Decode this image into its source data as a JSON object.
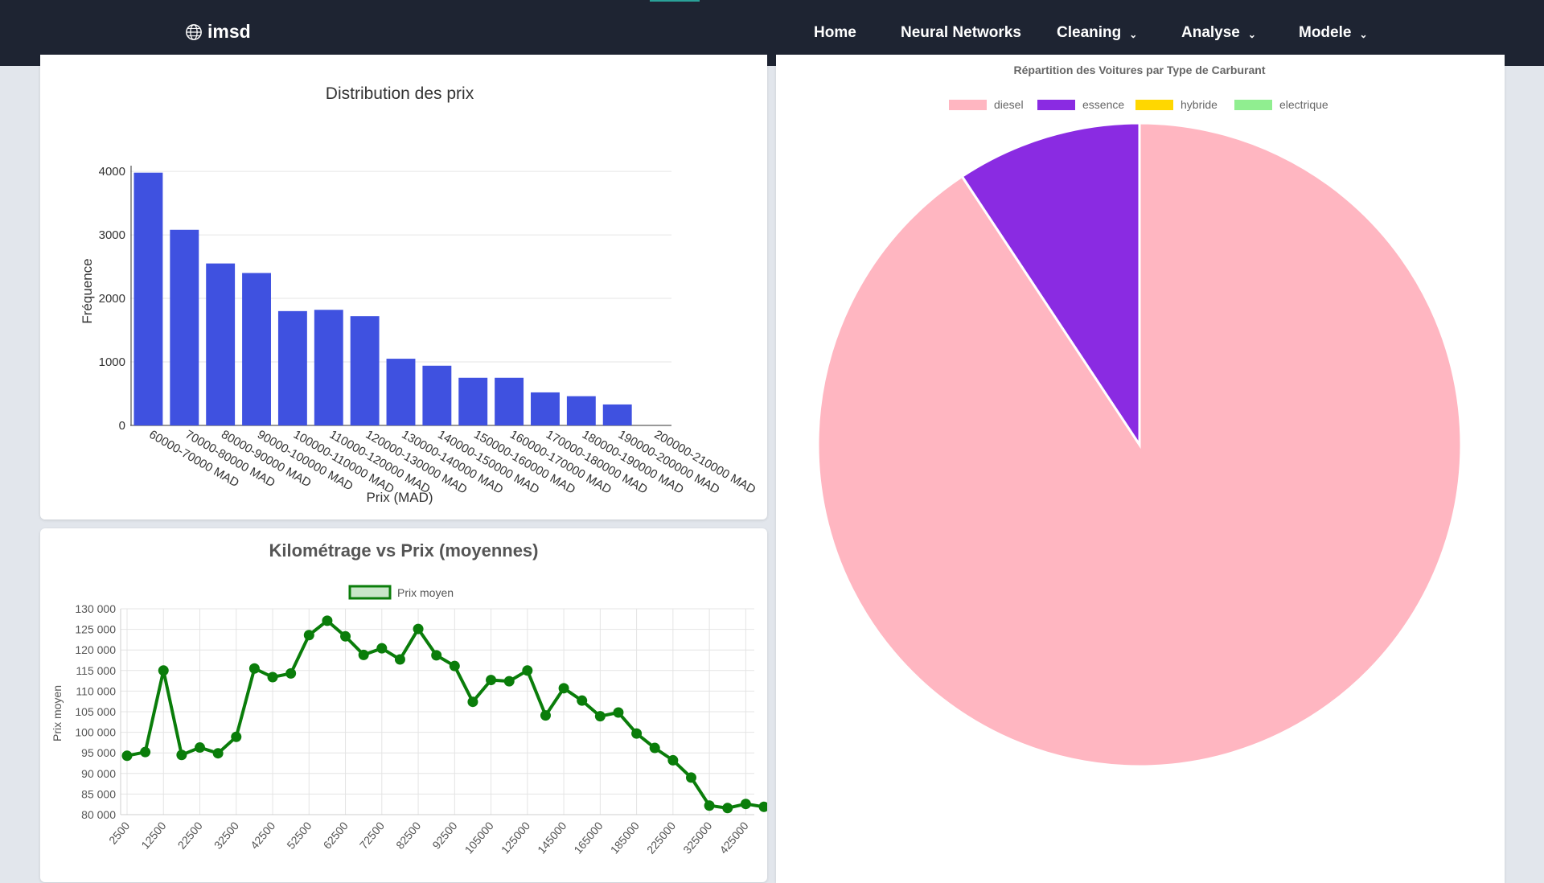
{
  "header": {
    "brand": "imsd",
    "nav": [
      {
        "label": "Home"
      },
      {
        "label": "Neural Networks"
      },
      {
        "label": "Cleaning"
      },
      {
        "label": "Analyse"
      },
      {
        "label": "Modele"
      }
    ]
  },
  "colors": {
    "navbar": "#1e2432",
    "bar": "#3f51e0",
    "line": "#0a7d0a",
    "diesel": "#ffb6c1",
    "essence": "#8a2be2",
    "hybride": "#ffd700",
    "electrique": "#90ee90"
  },
  "chart_data": [
    {
      "type": "bar",
      "title": "Distribution des prix",
      "xlabel": "Prix (MAD)",
      "ylabel": "Fréquence",
      "ylim": [
        0,
        4000
      ],
      "yticks": [
        0,
        1000,
        2000,
        3000,
        4000
      ],
      "grid": true,
      "categories": [
        "60000-70000 MAD",
        "70000-80000 MAD",
        "80000-90000 MAD",
        "90000-100000 MAD",
        "100000-110000 MAD",
        "110000-120000 MAD",
        "120000-130000 MAD",
        "130000-140000 MAD",
        "140000-150000 MAD",
        "150000-160000 MAD",
        "160000-170000 MAD",
        "170000-180000 MAD",
        "180000-190000 MAD",
        "190000-200000 MAD",
        "200000-210000 MAD"
      ],
      "values": [
        3980,
        3080,
        2550,
        2400,
        1800,
        1820,
        1720,
        1050,
        940,
        750,
        750,
        520,
        460,
        330,
        0
      ]
    },
    {
      "type": "line",
      "title": "Kilométrage vs Prix (moyennes)",
      "ylabel": "Prix moyen",
      "ylim": [
        80000,
        130000
      ],
      "yticks": [
        "80 000",
        "85 000",
        "90 000",
        "95 000",
        "100 000",
        "105 000",
        "110 000",
        "115 000",
        "120 000",
        "125 000",
        "130 000"
      ],
      "grid": true,
      "legend_position": "top",
      "series": [
        {
          "name": "Prix moyen",
          "values": [
            94300,
            95200,
            115000,
            94500,
            96300,
            94900,
            98900,
            115500,
            113400,
            114300,
            123600,
            127100,
            123300,
            118800,
            120400,
            117700,
            125100,
            118700,
            116100,
            107400,
            112700,
            112400,
            115000,
            104100,
            110700,
            107700,
            103900,
            104800,
            99700,
            96200,
            93200,
            89000,
            82200,
            81600,
            82600,
            81900
          ]
        }
      ],
      "x": [
        "2500",
        "7500",
        "12500",
        "17500",
        "22500",
        "27500",
        "32500",
        "37500",
        "42500",
        "47500",
        "52500",
        "57500",
        "62500",
        "67500",
        "72500",
        "77500",
        "82500",
        "87500",
        "92500",
        "97500",
        "105000",
        "115000",
        "125000",
        "135000",
        "145000",
        "155000",
        "165000",
        "175000",
        "185000",
        "195000",
        "225000",
        "275000",
        "325000",
        "375000",
        "425000",
        "475000"
      ],
      "xtick_labels": [
        "2500",
        "12500",
        "22500",
        "32500",
        "42500",
        "52500",
        "62500",
        "72500",
        "82500",
        "92500",
        "105000",
        "125000",
        "145000",
        "165000",
        "185000",
        "225000",
        "325000",
        "425000"
      ]
    },
    {
      "type": "pie",
      "title": "Répartition des Voitures par Type de Carburant",
      "legend_position": "top",
      "categories": [
        "diesel",
        "essence",
        "hybride",
        "electrique"
      ],
      "values": [
        90.7,
        9.3,
        0,
        0
      ]
    }
  ]
}
